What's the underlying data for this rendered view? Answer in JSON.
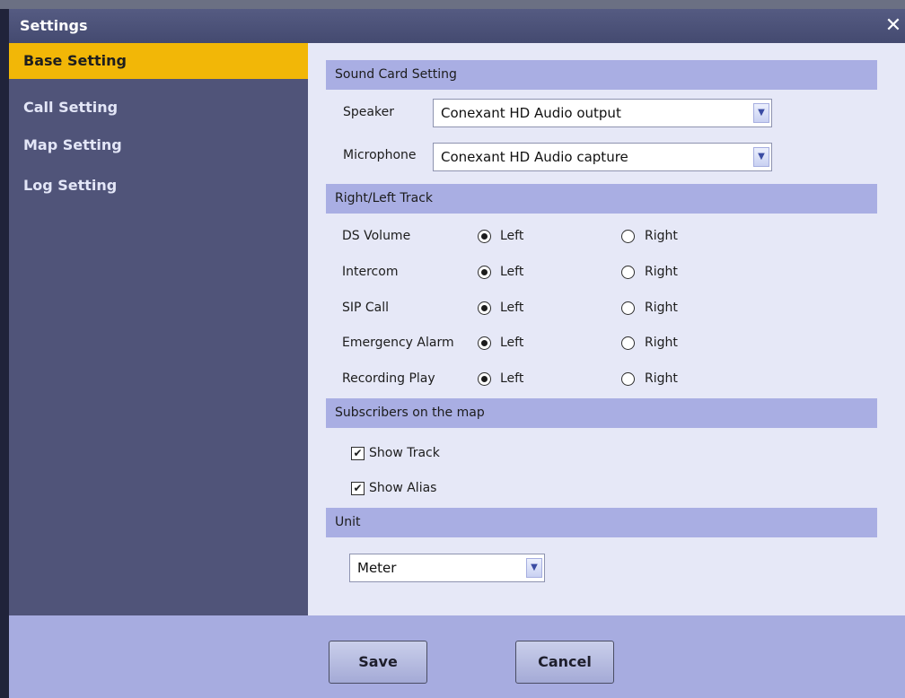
{
  "window": {
    "title": "Settings",
    "close_icon": "close-icon"
  },
  "sidebar": {
    "items": [
      {
        "label": "Base Setting",
        "active": true
      },
      {
        "label": "Call Setting",
        "active": false
      },
      {
        "label": "Map Setting",
        "active": false
      },
      {
        "label": "Log Setting",
        "active": false
      }
    ]
  },
  "sound_card": {
    "header": "Sound Card Setting",
    "speaker_label": "Speaker",
    "speaker_value": "Conexant HD Audio output",
    "microphone_label": "Microphone",
    "microphone_value": "Conexant HD Audio capture"
  },
  "track": {
    "header": "Right/Left Track",
    "left_label": "Left",
    "right_label": "Right",
    "rows": [
      {
        "label": "DS Volume",
        "selected": "Left"
      },
      {
        "label": "Intercom",
        "selected": "Left"
      },
      {
        "label": "SIP Call",
        "selected": "Left"
      },
      {
        "label": "Emergency Alarm",
        "selected": "Left"
      },
      {
        "label": "Recording Play",
        "selected": "Left"
      }
    ]
  },
  "map": {
    "header": "Subscribers on the map",
    "show_track_label": "Show Track",
    "show_track_checked": true,
    "show_alias_label": "Show Alias",
    "show_alias_checked": true
  },
  "unit": {
    "header": "Unit",
    "value": "Meter"
  },
  "footer": {
    "save_label": "Save",
    "cancel_label": "Cancel"
  },
  "colors": {
    "active_nav": "#f2b707",
    "sidebar_bg": "#505479",
    "content_bg": "#e6e8f7",
    "section_header_bg": "#a9aee3",
    "footer_bg": "#a7ace0"
  }
}
